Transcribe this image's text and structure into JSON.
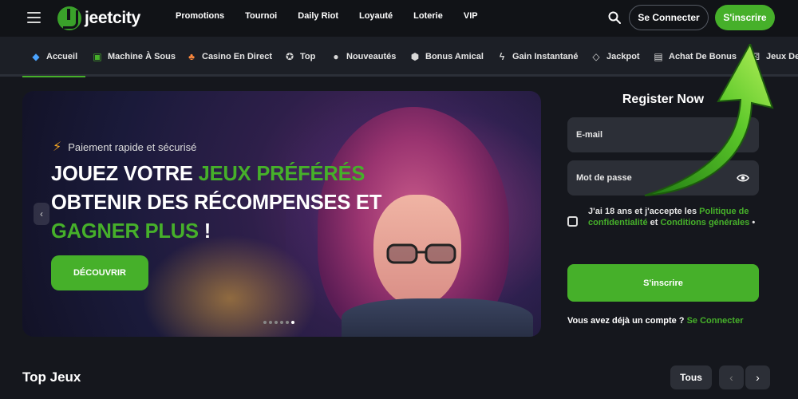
{
  "header": {
    "logo_text": "jeetcity",
    "nav": [
      "Promotions",
      "Tournoi",
      "Daily Riot",
      "Loyauté",
      "Loterie",
      "VIP"
    ],
    "login_label": "Se Connecter",
    "signup_label": "S'inscrire"
  },
  "categories": [
    {
      "label": "Accueil",
      "icon": "home-blocks-icon"
    },
    {
      "label": "Machine À Sous",
      "icon": "slot-machine-icon"
    },
    {
      "label": "Casino En Direct",
      "icon": "club-suit-icon"
    },
    {
      "label": "Top",
      "icon": "star-icon"
    },
    {
      "label": "Nouveautés",
      "icon": "new-badge-icon"
    },
    {
      "label": "Bonus Amical",
      "icon": "friend-bonus-icon"
    },
    {
      "label": "Gain Instantané",
      "icon": "lightning-icon"
    },
    {
      "label": "Jackpot",
      "icon": "diamond-icon"
    },
    {
      "label": "Achat De Bonus",
      "icon": "bonus-buy-icon"
    },
    {
      "label": "Jeux De",
      "icon": "dice-icon"
    }
  ],
  "banner": {
    "tagline": "Paiement rapide et sécurisé",
    "headline_1": "JOUEZ VOTRE ",
    "headline_1_green": "JEUX PRÉFÉRÉS",
    "headline_2": "OBTENIR DES RÉCOMPENSES ET",
    "headline_3_green": "GAGNER PLUS",
    "headline_3_end": " !",
    "cta_label": "DÉCOUVRIR",
    "slide_count": 6,
    "active_slide": 6
  },
  "register": {
    "title": "Register Now",
    "email_placeholder": "E-mail",
    "password_placeholder": "Mot de passe",
    "terms_prefix": "J'ai 18 ans et j'accepte les ",
    "terms_privacy": "Politique de confidentialité",
    "terms_and": " et ",
    "terms_conditions": "Conditions générales",
    "terms_suffix": " •",
    "submit_label": "S'inscrire",
    "have_account": "Vous avez déjà un compte ? ",
    "login_link": "Se Connecter"
  },
  "games": {
    "section_title": "Top Jeux",
    "all_label": "Tous"
  },
  "colors": {
    "brand_green": "#46b02a",
    "background": "#15171d",
    "field_bg": "#2c2f37"
  }
}
